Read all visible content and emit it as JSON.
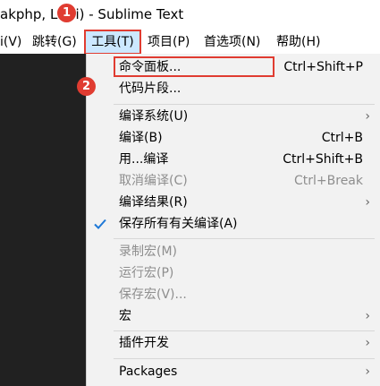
{
  "window": {
    "title": "akphp, Lar  i) - Sublime Text"
  },
  "menubar": {
    "items": [
      {
        "label": "i(V)"
      },
      {
        "label": "跳转(G)"
      },
      {
        "label": "工具(T)"
      },
      {
        "label": "项目(P)"
      },
      {
        "label": "首选项(N)"
      },
      {
        "label": "帮助(H)"
      }
    ]
  },
  "badges": [
    "1",
    "2"
  ],
  "tools_menu": {
    "items": [
      {
        "label": "命令面板...",
        "shortcut": "Ctrl+Shift+P"
      },
      {
        "label": "代码片段..."
      },
      {
        "label": "编译系统(U)",
        "submenu": true
      },
      {
        "label": "编译(B)",
        "shortcut": "Ctrl+B"
      },
      {
        "label": "用...编译",
        "shortcut": "Ctrl+Shift+B"
      },
      {
        "label": "取消编译(C)",
        "shortcut": "Ctrl+Break",
        "disabled": true
      },
      {
        "label": "编译结果(R)",
        "submenu": true
      },
      {
        "label": "保存所有有关编译(A)",
        "checked": true
      },
      {
        "label": "录制宏(M)",
        "disabled": true
      },
      {
        "label": "运行宏(P)",
        "disabled": true
      },
      {
        "label": "保存宏(V)...",
        "disabled": true
      },
      {
        "label": "宏",
        "submenu": true
      },
      {
        "label": "插件开发",
        "submenu": true
      },
      {
        "label": "Packages",
        "submenu": true
      }
    ]
  },
  "colors": {
    "highlight_red": "#e03c31",
    "menu_active_bg": "#cce8ff",
    "check_blue": "#1e78d7"
  }
}
